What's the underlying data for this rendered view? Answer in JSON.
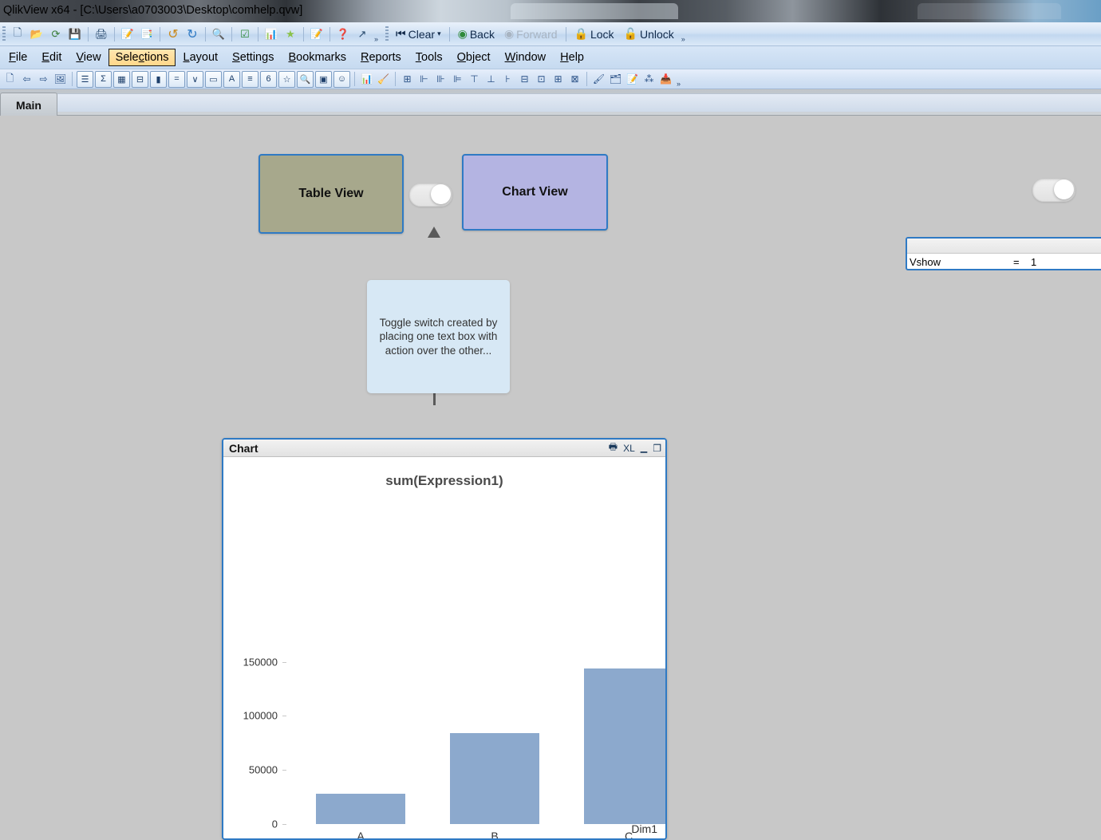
{
  "window": {
    "title": "QlikView x64 - [C:\\Users\\a0703003\\Desktop\\comhelp.qvw]"
  },
  "toolbar_main": {
    "icons": [
      {
        "name": "new-icon",
        "glyph": "🗋"
      },
      {
        "name": "open-icon",
        "glyph": "📂"
      },
      {
        "name": "reload-icon",
        "glyph": "⟳"
      },
      {
        "name": "save-icon",
        "glyph": "💾"
      },
      {
        "name": "print-icon",
        "glyph": "🖨"
      },
      {
        "name": "edit-script-icon",
        "glyph": "📝"
      },
      {
        "name": "table-viewer-icon",
        "glyph": "📑"
      },
      {
        "name": "undo-icon",
        "glyph": "↺"
      },
      {
        "name": "redo-icon",
        "glyph": "↻"
      },
      {
        "name": "search-icon",
        "glyph": "🔍"
      },
      {
        "name": "current-selections-icon",
        "glyph": "☑"
      },
      {
        "name": "quick-chart-icon",
        "glyph": "📊"
      },
      {
        "name": "add-bookmark-icon",
        "glyph": "★"
      },
      {
        "name": "edit-module-icon",
        "glyph": "📝"
      },
      {
        "name": "help-icon",
        "glyph": "?"
      },
      {
        "name": "context-help-icon",
        "glyph": "↗"
      }
    ],
    "clear_label": "Clear",
    "back_label": "Back",
    "forward_label": "Forward",
    "lock_label": "Lock",
    "unlock_label": "Unlock"
  },
  "menubar": {
    "items": [
      {
        "pre": "",
        "accel": "F",
        "post": "ile",
        "active": false,
        "name": "menu-file"
      },
      {
        "pre": "",
        "accel": "E",
        "post": "dit",
        "active": false,
        "name": "menu-edit"
      },
      {
        "pre": "",
        "accel": "V",
        "post": "iew",
        "active": false,
        "name": "menu-view"
      },
      {
        "pre": "Sele",
        "accel": "c",
        "post": "tions",
        "active": true,
        "name": "menu-selections"
      },
      {
        "pre": "",
        "accel": "L",
        "post": "ayout",
        "active": false,
        "name": "menu-layout"
      },
      {
        "pre": "",
        "accel": "S",
        "post": "ettings",
        "active": false,
        "name": "menu-settings"
      },
      {
        "pre": "",
        "accel": "B",
        "post": "ookmarks",
        "active": false,
        "name": "menu-bookmarks"
      },
      {
        "pre": "",
        "accel": "R",
        "post": "eports",
        "active": false,
        "name": "menu-reports"
      },
      {
        "pre": "",
        "accel": "T",
        "post": "ools",
        "active": false,
        "name": "menu-tools"
      },
      {
        "pre": "",
        "accel": "O",
        "post": "bject",
        "active": false,
        "name": "menu-object"
      },
      {
        "pre": "",
        "accel": "W",
        "post": "indow",
        "active": false,
        "name": "menu-window"
      },
      {
        "pre": "",
        "accel": "H",
        "post": "elp",
        "active": false,
        "name": "menu-help"
      }
    ]
  },
  "toolbar_design": {
    "icons": [
      {
        "name": "new-sheet-icon",
        "glyph": "🗋",
        "boxed": false
      },
      {
        "name": "previous-sheet-icon",
        "glyph": "⇦",
        "boxed": false
      },
      {
        "name": "next-sheet-icon",
        "glyph": "⇨",
        "boxed": false
      },
      {
        "name": "sheet-properties-icon",
        "glyph": "🖼",
        "boxed": false
      },
      {
        "name": "list-box-icon",
        "glyph": "☰",
        "boxed": true
      },
      {
        "name": "statistics-box-icon",
        "glyph": "Σ",
        "boxed": true
      },
      {
        "name": "table-box-icon",
        "glyph": "▦",
        "boxed": true
      },
      {
        "name": "pivot-table-icon",
        "glyph": "⊟",
        "boxed": true
      },
      {
        "name": "chart-icon",
        "glyph": "▮",
        "boxed": true
      },
      {
        "name": "input-box-icon",
        "glyph": "=",
        "boxed": true
      },
      {
        "name": "multi-box-icon",
        "glyph": "∨",
        "boxed": true
      },
      {
        "name": "button-icon",
        "glyph": "▭",
        "boxed": true
      },
      {
        "name": "text-object-icon",
        "glyph": "A",
        "boxed": true
      },
      {
        "name": "line-arrow-icon",
        "glyph": "≡",
        "boxed": true
      },
      {
        "name": "slider-calendar-icon",
        "glyph": "6",
        "boxed": true
      },
      {
        "name": "bookmark-object-icon",
        "glyph": "☆",
        "boxed": true
      },
      {
        "name": "search-object-icon",
        "glyph": "🔍",
        "boxed": true
      },
      {
        "name": "container-icon",
        "glyph": "▣",
        "boxed": true
      },
      {
        "name": "custom-object-icon",
        "glyph": "☺",
        "boxed": true
      },
      {
        "name": "design-grid-icon",
        "glyph": "📊",
        "boxed": false
      },
      {
        "name": "clear-format-icon",
        "glyph": "🧹",
        "boxed": false
      },
      {
        "name": "snap-grid-icon",
        "glyph": "⊞",
        "boxed": false
      },
      {
        "name": "align-left-icon",
        "glyph": "⊩",
        "boxed": false
      },
      {
        "name": "align-center-h-icon",
        "glyph": "⊪",
        "boxed": false
      },
      {
        "name": "align-right-icon",
        "glyph": "⊫",
        "boxed": false
      },
      {
        "name": "align-top-icon",
        "glyph": "⊤",
        "boxed": false
      },
      {
        "name": "align-middle-icon",
        "glyph": "⊥",
        "boxed": false
      },
      {
        "name": "align-bottom-icon",
        "glyph": "⊦",
        "boxed": false
      },
      {
        "name": "distribute-v-icon",
        "glyph": "⊟",
        "boxed": false
      },
      {
        "name": "distribute-h-icon",
        "glyph": "⊡",
        "boxed": false
      },
      {
        "name": "space-evenly-icon",
        "glyph": "⊞",
        "boxed": false
      },
      {
        "name": "resize-icon",
        "glyph": "⊠",
        "boxed": false
      },
      {
        "name": "promote-icon",
        "glyph": "🖌",
        "boxed": false
      },
      {
        "name": "bring-front-icon",
        "glyph": "🗂",
        "boxed": false
      },
      {
        "name": "edit-object-icon",
        "glyph": "📝",
        "boxed": false
      },
      {
        "name": "share-icon",
        "glyph": "⁂",
        "boxed": false
      },
      {
        "name": "publish-icon",
        "glyph": "📥",
        "boxed": false
      }
    ]
  },
  "sheet_tabs": {
    "active_tab": "Main"
  },
  "canvas": {
    "table_view_button": "Table View",
    "chart_view_button": "Chart View",
    "callout_text": "Toggle switch created by placing one text box with action over the other...",
    "toggle_main": {
      "state": "on",
      "name": "toggle-switch-main"
    },
    "toggle_right": {
      "state": "on",
      "name": "toggle-switch-right"
    },
    "variable_box": {
      "variable_name": "Vshow",
      "equals": "=",
      "value": "1"
    }
  },
  "chart_object": {
    "caption_title": "Chart",
    "caption_icons": [
      {
        "name": "print-chart-icon",
        "glyph": "🖶"
      },
      {
        "name": "export-to-excel-icon",
        "glyph": "XL"
      },
      {
        "name": "minimize-icon",
        "glyph": "▁"
      },
      {
        "name": "maximize-icon",
        "glyph": "❐"
      }
    ]
  },
  "colors": {
    "bar": "#8ca9cd",
    "object_border": "#2f7ac4",
    "table_view_bg": "#a7a88c",
    "chart_view_bg": "#b4b4e2",
    "callout_bg": "#d7e8f5",
    "canvas_bg": "#c8c8c8",
    "menu_highlight": "#ffd78a"
  },
  "chart_data": {
    "type": "bar",
    "title": "sum(Expression1)",
    "xlabel": "Dim1",
    "ylabel": "",
    "categories": [
      "A",
      "B",
      "C"
    ],
    "values": [
      27700,
      84400,
      143800
    ],
    "ylim": [
      0,
      160000
    ],
    "yticks": [
      0,
      50000,
      100000,
      150000
    ],
    "ytick_labels": [
      "0",
      "50000",
      "100000",
      "150000"
    ],
    "grid": false,
    "legend": "none",
    "series": [
      {
        "name": "sum(Expression1)",
        "values": [
          27700,
          84400,
          143800
        ],
        "color": "#8ca9cd"
      }
    ]
  }
}
